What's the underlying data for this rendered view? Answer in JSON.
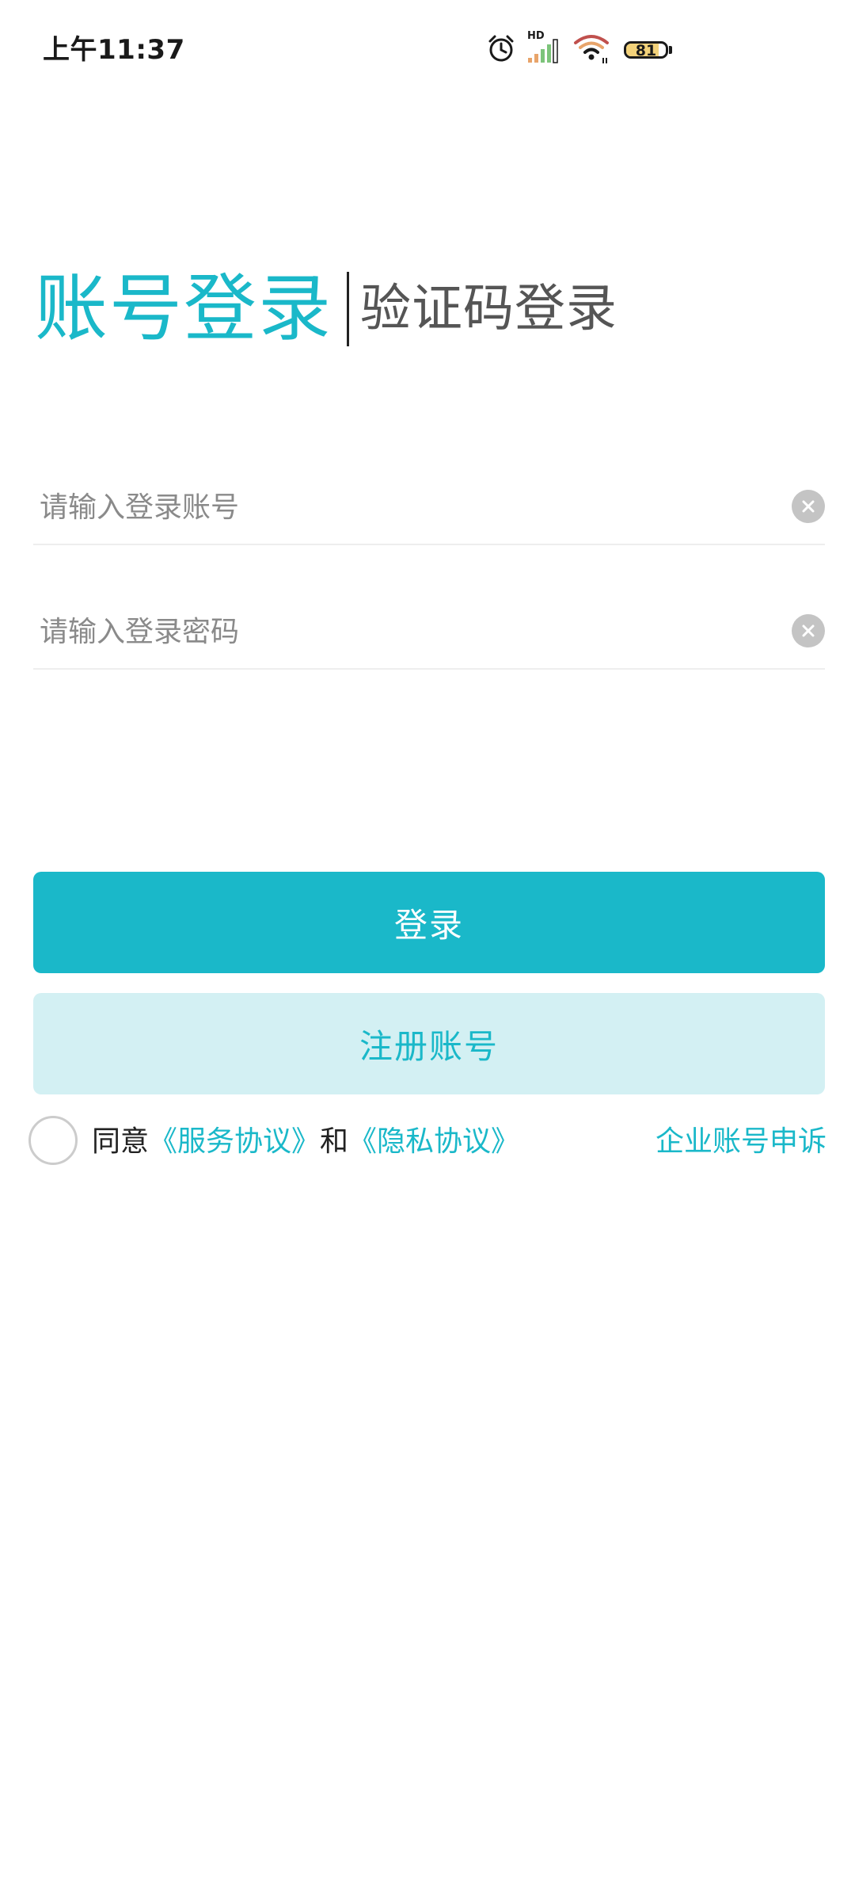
{
  "status_bar": {
    "time": "上午11:37",
    "signal_label": "HD",
    "battery_level": "81",
    "icons": [
      "alarm-icon",
      "signal-icon",
      "wifi-icon",
      "battery-icon"
    ]
  },
  "tabs": {
    "active_label": "账号登录",
    "inactive_label": "验证码登录"
  },
  "form": {
    "account_placeholder": "请输入登录账号",
    "account_value": "",
    "password_placeholder": "请输入登录密码",
    "password_value": ""
  },
  "buttons": {
    "login_label": "登录",
    "register_label": "注册账号"
  },
  "agreement": {
    "prefix": "同意",
    "service_link": "《服务协议》",
    "connector": "和",
    "privacy_link": "《隐私协议》",
    "checked": false
  },
  "appeal_link": "企业账号申诉",
  "colors": {
    "accent": "#1ab8c9",
    "accent_light": "#d3f0f3",
    "placeholder": "#8a8a8a",
    "text": "#222222"
  }
}
